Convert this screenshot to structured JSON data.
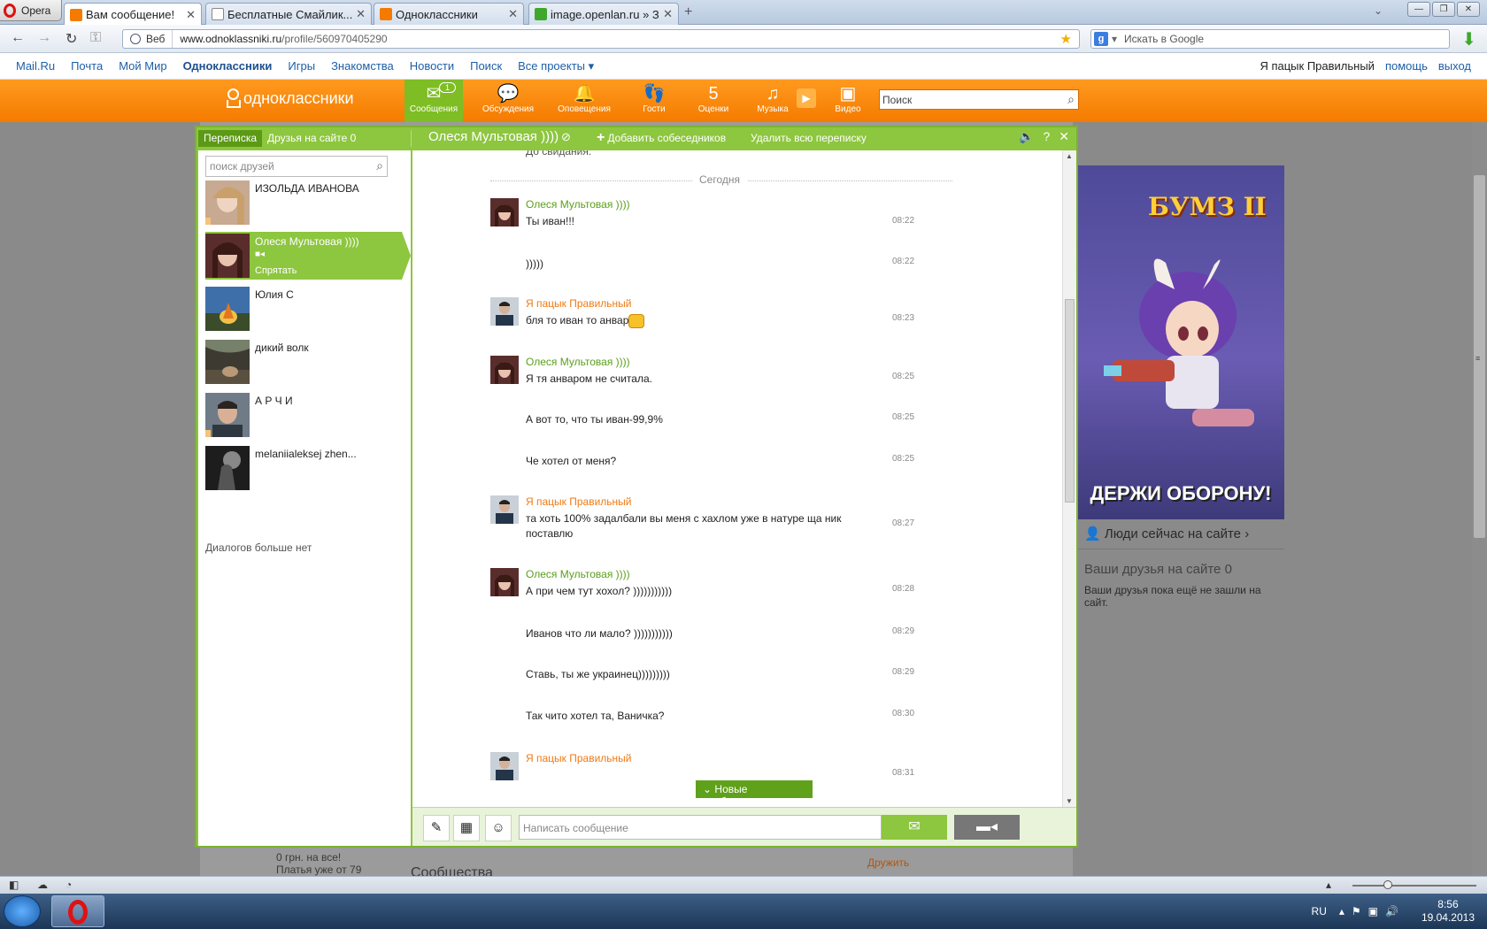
{
  "browser": {
    "menu_label": "Opera",
    "tabs": [
      {
        "title": "Вам сообщение!",
        "favicon_color": "#f47b00"
      },
      {
        "title": "Бесплатные Смайлик...",
        "favicon_color": "#ffffff"
      },
      {
        "title": "Одноклассники",
        "favicon_color": "#f47b00"
      },
      {
        "title": "image.openlan.ru » Заг...",
        "favicon_color": "#3fa82c"
      }
    ],
    "address_badge": "Веб",
    "url_host": "www.odnoklassniki.ru",
    "url_path": "/profile/560970405290",
    "search_placeholder": "Искать в Google"
  },
  "portal": {
    "links": [
      "Mail.Ru",
      "Почта",
      "Мой Мир",
      "Одноклассники",
      "Игры",
      "Знакомства",
      "Новости",
      "Поиск",
      "Все проекты ▾"
    ],
    "user": "Я пацык Правильный",
    "help": "помощь",
    "logout": "выход"
  },
  "ok": {
    "logo": "одноклассники",
    "nav": [
      {
        "label": "Сообщения",
        "icon": "✉",
        "badge": "1"
      },
      {
        "label": "Обсуждения",
        "icon": "💬"
      },
      {
        "label": "Оповещения",
        "icon": "🔔"
      },
      {
        "label": "Гости",
        "icon": "👣"
      },
      {
        "label": "Оценки",
        "icon": "5"
      },
      {
        "label": "Музыка",
        "icon": "♫"
      },
      {
        "label": "Видео",
        "icon": "▣"
      }
    ],
    "search_placeholder": "Поиск"
  },
  "chat": {
    "tab_conversations": "Переписка",
    "tab_friends_online": "Друзья на сайте 0",
    "title": "Олеся Мультовая ))))",
    "add_participants": "Добавить собеседников",
    "delete_all": "Удалить всю переписку",
    "contacts_search_placeholder": "поиск друзей",
    "contacts": [
      {
        "name": "ИЗОЛЬДА ИВАНОВА"
      },
      {
        "name": "Олеся Мультовая ))))",
        "hide": "Спрятать"
      },
      {
        "name": "Юлия С"
      },
      {
        "name": "дикий волк"
      },
      {
        "name": "А Р Ч И"
      },
      {
        "name": "melaniialeksej zhen..."
      }
    ],
    "no_more_dialogs": "Диалогов больше нет",
    "top_cut_text": "До свидания.",
    "day_separator": "Сегодня",
    "messages": [
      {
        "author": "Олеся Мультовая ))))",
        "text": "Ты иван!!!",
        "time": "08:22"
      },
      {
        "text": ")))))",
        "time": "08:22"
      },
      {
        "author": "Я пацык Правильный",
        "text": "бля то иван то анвар",
        "time": "08:23"
      },
      {
        "author": "Олеся Мультовая ))))",
        "text": "Я тя анваром не считала.",
        "time": "08:25"
      },
      {
        "text": "А вот то, что ты иван-99,9%",
        "time": "08:25"
      },
      {
        "text": "Че хотел от меня?",
        "time": "08:25"
      },
      {
        "author": "Я пацык Правильный",
        "text": "та хоть 100% задалбали вы меня с хахлом уже в натуре ща ник поставлю",
        "time": "08:27"
      },
      {
        "author": "Олеся Мультовая ))))",
        "text": "А при чем тут хохол? )))))))))))",
        "time": "08:28"
      },
      {
        "text": "Иванов что ли мало? )))))))))))",
        "time": "08:29"
      },
      {
        "text": "Ставь, ты же украинец)))))))))",
        "time": "08:29"
      },
      {
        "text": "Так чито хотел та, Ваничка?",
        "time": "08:30"
      },
      {
        "author": "Я пацык Правильный",
        "text": "",
        "time": "08:31"
      }
    ],
    "new_messages": "Новые сообщения",
    "composer_placeholder": "Написать сообщение"
  },
  "page": {
    "stub1": "0 грн. на все!",
    "stub2": "Платья уже от 79",
    "stub3": "Сообщества",
    "stub4": "Дружить",
    "ad_logo": "БУМЗ II",
    "ad_text": "ДЕРЖИ ОБОРОНУ!",
    "people_online": "Люди сейчас на сайте ›",
    "friends_online_title": "Ваши друзья на сайте",
    "friends_online_count": "0",
    "friends_online_text": "Ваши друзья пока ещё не зашли на сайт."
  },
  "taskbar": {
    "lang": "RU",
    "time": "8:56",
    "date": "19.04.2013"
  }
}
